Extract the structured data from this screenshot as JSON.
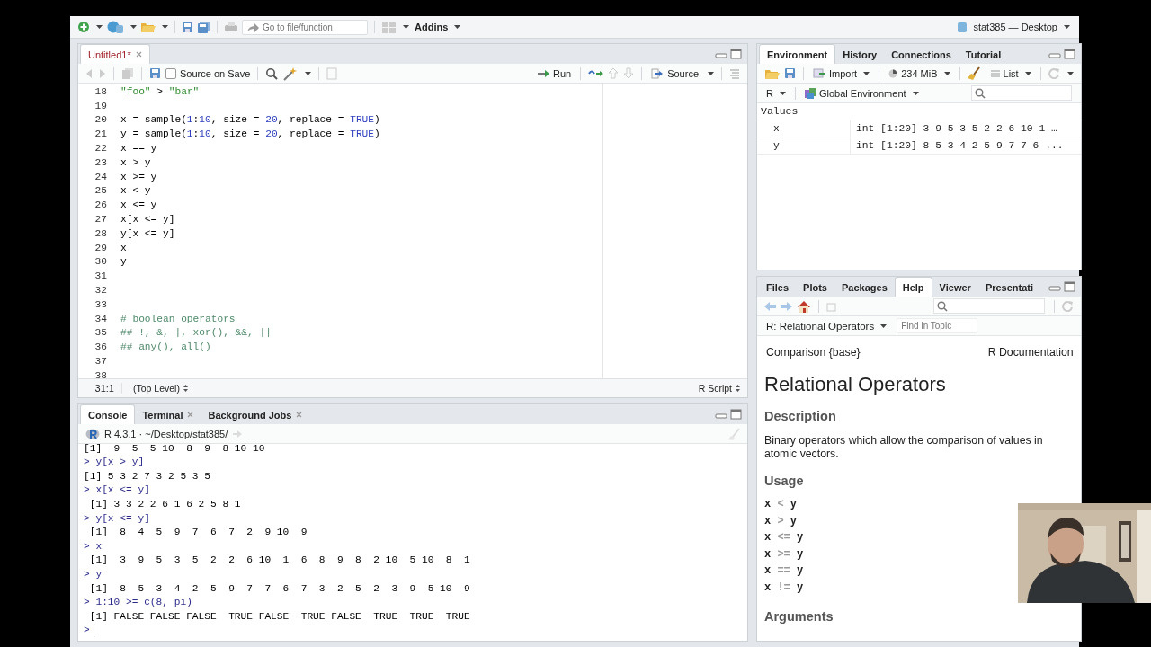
{
  "window": {
    "title": "stat385 — Desktop"
  },
  "main_toolbar": {
    "goto_placeholder": "Go to file/function",
    "addins": "Addins"
  },
  "editor": {
    "tabs": [
      {
        "label": "Untitled1*",
        "selected": true,
        "modified": true
      }
    ],
    "toolbar": {
      "source_on_save": {
        "label": "Source on Save",
        "checked": false
      },
      "run": "Run",
      "source": "Source"
    },
    "lines": [
      {
        "number": "18",
        "code": "\"foo\" > \"bar\""
      },
      {
        "number": "19"
      },
      {
        "number": "20",
        "code": "x = sample(1:10, size = 20, replace = TRUE)"
      },
      {
        "number": "21",
        "code": "y = sample(1:10, size = 20, replace = TRUE)"
      },
      {
        "number": "22",
        "code": "x == y"
      },
      {
        "number": "23",
        "code": "x > y"
      },
      {
        "number": "24",
        "code": "x >= y"
      },
      {
        "number": "25",
        "code": "x < y"
      },
      {
        "number": "26",
        "code": "x <= y"
      },
      {
        "number": "27",
        "code": "x[x <= y]"
      },
      {
        "number": "28",
        "code": "y[x <= y]"
      },
      {
        "number": "29",
        "code": "x"
      },
      {
        "number": "30",
        "code": "y"
      },
      {
        "number": "31"
      },
      {
        "number": "32"
      },
      {
        "number": "33"
      },
      {
        "number": "34",
        "code": "# boolean operators"
      },
      {
        "number": "35",
        "code": "## !, &, |, xor(), &&, ||"
      },
      {
        "number": "36",
        "code": "## any(), all()"
      },
      {
        "number": "37"
      },
      {
        "number": "38"
      }
    ],
    "status": {
      "position": "31:1",
      "scope": "(Top Level)",
      "file_type": "R Script"
    }
  },
  "console": {
    "tabs": [
      {
        "label": "Console",
        "selected": true,
        "closable": false
      },
      {
        "label": "Terminal",
        "selected": false,
        "closable": true
      },
      {
        "label": "Background Jobs",
        "selected": false,
        "closable": true
      }
    ],
    "header": "R 4.3.1 · ~/Desktop/stat385/",
    "lines": [
      {
        "kind": "output",
        "text": "[1]  9  5  5 10  8  9  8 10 10"
      },
      {
        "kind": "input",
        "text": "> y[x > y]"
      },
      {
        "kind": "output",
        "text": "[1] 5 3 2 7 3 2 5 3 5"
      },
      {
        "kind": "input",
        "text": "> x[x <= y]"
      },
      {
        "kind": "output",
        "text": " [1] 3 3 2 2 6 1 6 2 5 8 1"
      },
      {
        "kind": "input",
        "text": "> y[x <= y]"
      },
      {
        "kind": "output",
        "text": " [1]  8  4  5  9  7  6  7  2  9 10  9"
      },
      {
        "kind": "input",
        "text": "> x"
      },
      {
        "kind": "output",
        "text": " [1]  3  9  5  3  5  2  2  6 10  1  6  8  9  8  2 10  5 10  8  1"
      },
      {
        "kind": "input",
        "text": "> y"
      },
      {
        "kind": "output",
        "text": " [1]  8  5  3  4  2  5  9  7  7  6  7  3  2  5  2  3  9  5 10  9"
      },
      {
        "kind": "input",
        "text": "> 1:10 >= c(8, pi)"
      },
      {
        "kind": "output",
        "text": " [1] FALSE FALSE FALSE  TRUE FALSE  TRUE FALSE  TRUE  TRUE  TRUE"
      },
      {
        "kind": "prompt",
        "text": ">"
      }
    ]
  },
  "environment": {
    "tabs": [
      {
        "label": "Environment",
        "selected": true
      },
      {
        "label": "History",
        "selected": false
      },
      {
        "label": "Connections",
        "selected": false
      },
      {
        "label": "Tutorial",
        "selected": false
      }
    ],
    "toolbar": {
      "import": "Import",
      "memory": "234 MiB",
      "view": "List"
    },
    "language": "R",
    "scope": "Global Environment",
    "section": "Values",
    "rows": [
      {
        "name": "x",
        "value": "int [1:20] 3 9 5 3 5 2 2 6 10 1 …"
      },
      {
        "name": "y",
        "value": "int [1:20] 8 5 3 4 2 5 9 7 7 6 ..."
      }
    ]
  },
  "help": {
    "tabs": [
      {
        "label": "Files",
        "selected": false
      },
      {
        "label": "Plots",
        "selected": false
      },
      {
        "label": "Packages",
        "selected": false
      },
      {
        "label": "Help",
        "selected": true
      },
      {
        "label": "Viewer",
        "selected": false
      },
      {
        "label": "Presentati",
        "selected": false
      }
    ],
    "topic": "R: Relational Operators",
    "find_placeholder": "Find in Topic",
    "doc": {
      "package": "Comparison {base}",
      "source": "R Documentation",
      "title": "Relational Operators",
      "sections": [
        {
          "heading": "Description",
          "text": "Binary operators which allow the comparison of values in atomic vectors."
        },
        {
          "heading": "Usage",
          "usage": [
            [
              "x",
              "<",
              "y"
            ],
            [
              "x",
              ">",
              "y"
            ],
            [
              "x",
              "<=",
              "y"
            ],
            [
              "x",
              ">=",
              "y"
            ],
            [
              "x",
              "==",
              "y"
            ],
            [
              "x",
              "!=",
              "y"
            ]
          ]
        },
        {
          "heading": "Arguments"
        }
      ]
    }
  }
}
